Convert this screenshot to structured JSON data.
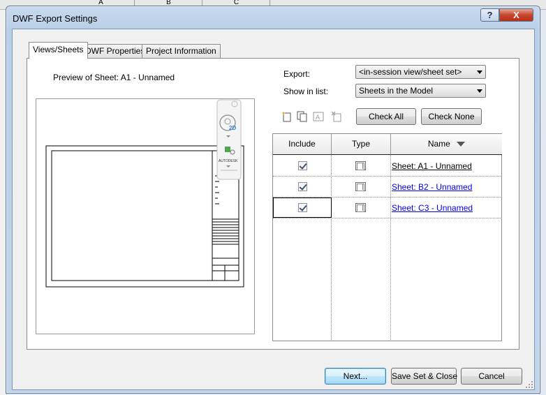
{
  "background": {
    "columns": [
      "A",
      "B",
      "C"
    ]
  },
  "window": {
    "title": "DWF Export Settings",
    "help_label": "?",
    "close_label": "X"
  },
  "tabs": [
    {
      "label": "Views/Sheets",
      "active": true
    },
    {
      "label": "DWF Properties",
      "active": false
    },
    {
      "label": "Project Information",
      "active": false
    }
  ],
  "preview": {
    "label": "Preview of Sheet: A1 - Unnamed",
    "nav_2d": "2D",
    "nav_brand": "AUTODESK"
  },
  "export": {
    "label": "Export:",
    "value": "<in-session view/sheet set>"
  },
  "show_in_list": {
    "label": "Show in list:",
    "value": "Sheets in the Model"
  },
  "toolbar": {
    "icons": [
      "new-set-icon",
      "duplicate-set-icon",
      "rename-set-icon",
      "delete-set-icon"
    ]
  },
  "buttons": {
    "check_all": "Check All",
    "check_none": "Check None",
    "next": "Next...",
    "save_set_close": "Save Set & Close",
    "cancel": "Cancel"
  },
  "table": {
    "headers": {
      "include": "Include",
      "type": "Type",
      "name": "Name"
    },
    "rows": [
      {
        "checked": true,
        "type_icon": "sheet-icon",
        "name": "Sheet: A1 - Unnamed",
        "visited": true
      },
      {
        "checked": true,
        "type_icon": "sheet-icon",
        "name": "Sheet: B2 - Unnamed",
        "visited": false
      },
      {
        "checked": true,
        "type_icon": "sheet-icon",
        "name": "Sheet: C3 - Unnamed",
        "visited": false
      }
    ]
  },
  "colors": {
    "link": "#0000ee",
    "visited_link": "#000000",
    "title_bar": "#b9cfe8",
    "close_button": "#c8452c"
  }
}
